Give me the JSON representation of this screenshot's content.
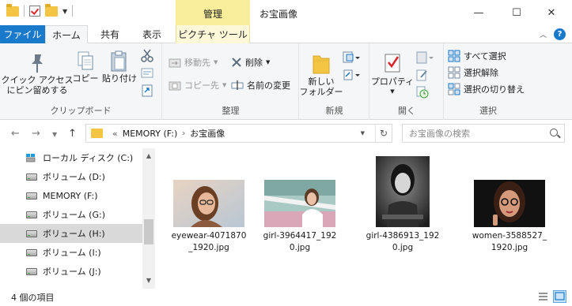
{
  "window": {
    "title": "お宝画像",
    "context_group": "管理",
    "controls": {
      "minimize": "—",
      "maximize": "☐",
      "close": "✕"
    }
  },
  "tabs": [
    {
      "label": "ファイル"
    },
    {
      "label": "ホーム",
      "active": true
    },
    {
      "label": "共有"
    },
    {
      "label": "表示"
    },
    {
      "label": "ピクチャ ツール",
      "context": true
    }
  ],
  "ribbon": {
    "clipboard": {
      "group_label": "クリップボード",
      "pin_label": "クイック アクセス\nにピン留めする",
      "copy_label": "コピー",
      "paste_label": "貼り付け"
    },
    "organize": {
      "group_label": "整理",
      "move_to": "移動先",
      "copy_to": "コピー先",
      "delete": "削除",
      "rename": "名前の変更"
    },
    "new": {
      "group_label": "新規",
      "new_folder": "新しい\nフォルダー"
    },
    "open": {
      "group_label": "開く",
      "properties": "プロパティ"
    },
    "select": {
      "group_label": "選択",
      "select_all": "すべて選択",
      "select_none": "選択解除",
      "invert": "選択の切り替え"
    }
  },
  "address": {
    "prefix": "«",
    "segments": [
      "MEMORY (F:)",
      "お宝画像"
    ],
    "search_placeholder": "お宝画像の検索"
  },
  "nav": {
    "items": [
      {
        "label": "ローカル ディスク (C:)",
        "icon": "windows-drive-icon"
      },
      {
        "label": "ボリューム (D:)",
        "icon": "drive-icon"
      },
      {
        "label": "MEMORY (F:)",
        "icon": "drive-icon"
      },
      {
        "label": "ボリューム (G:)",
        "icon": "drive-icon"
      },
      {
        "label": "ボリューム (H:)",
        "icon": "drive-icon",
        "selected": true
      },
      {
        "label": "ボリューム (I:)",
        "icon": "drive-icon"
      },
      {
        "label": "ボリューム (J:)",
        "icon": "drive-icon"
      }
    ]
  },
  "files": [
    {
      "name": "eyewear-4071870\n_1920.jpg"
    },
    {
      "name": "girl-3964417_192\n0.jpg"
    },
    {
      "name": "girl-4386913_192\n0.jpg"
    },
    {
      "name": "women-3588527_\n1920.jpg"
    }
  ],
  "status": {
    "count_text": "4 個の項目"
  },
  "colors": {
    "accent": "#1979ca",
    "context_tab": "#f7ed9a",
    "selected_nav": "#d9d9d9"
  }
}
